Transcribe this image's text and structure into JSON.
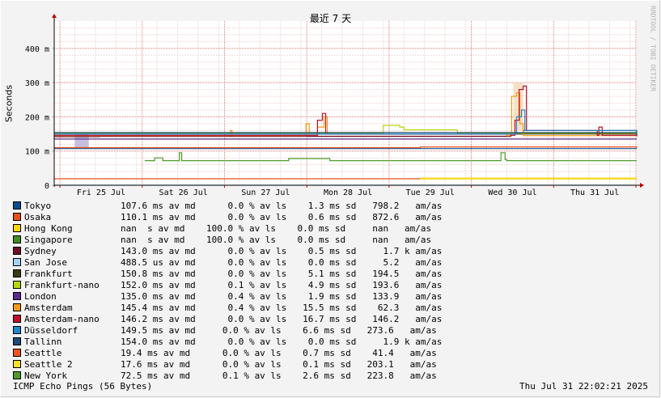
{
  "chart_data": {
    "type": "line",
    "title": "最近 7 天",
    "ylabel": "Seconds",
    "watermark": "RRDTOOL / TOBI OETIKER",
    "ylim": [
      0,
      0.48
    ],
    "yticks": [
      {
        "value": 0,
        "label": "0"
      },
      {
        "value": 0.1,
        "label": "100 m"
      },
      {
        "value": 0.2,
        "label": "200 m"
      },
      {
        "value": 0.3,
        "label": "300 m"
      },
      {
        "value": 0.4,
        "label": "400 m"
      }
    ],
    "xlim_days": [
      0,
      7.08
    ],
    "xticks": [
      {
        "day": 0.57,
        "label": "Fri 25 Jul"
      },
      {
        "day": 1.57,
        "label": "Sat 26 Jul"
      },
      {
        "day": 2.57,
        "label": "Sun 27 Jul"
      },
      {
        "day": 3.57,
        "label": "Mon 28 Jul"
      },
      {
        "day": 4.57,
        "label": "Tue 29 Jul"
      },
      {
        "day": 5.57,
        "label": "Wed 30 Jul"
      },
      {
        "day": 6.57,
        "label": "Thu 31 Jul"
      }
    ],
    "series": [
      {
        "name": "Tokyo",
        "color": "#0a4f8a",
        "points": [
          [
            0,
            0.107
          ],
          [
            7.08,
            0.107
          ]
        ]
      },
      {
        "name": "Osaka",
        "color": "#e8501d",
        "points": [
          [
            0,
            0.11
          ],
          [
            4.45,
            0.11
          ],
          [
            4.45,
            0.112
          ],
          [
            7.08,
            0.11
          ]
        ]
      },
      {
        "name": "Hong Kong",
        "color": "#f8d60f",
        "points": [
          [
            4.45,
            0.021
          ],
          [
            7.08,
            0.021
          ]
        ]
      },
      {
        "name": "Singapore",
        "color": "#3f8f1e",
        "points": [
          [
            0,
            0.0
          ],
          [
            0,
            0.0
          ]
        ]
      },
      {
        "name": "Sydney",
        "color": "#6b0f24",
        "points": [
          [
            0,
            0.142
          ],
          [
            0.55,
            0.142
          ],
          [
            0.55,
            0.143
          ],
          [
            5.5,
            0.143
          ],
          [
            5.55,
            0.15
          ],
          [
            5.7,
            0.16
          ],
          [
            7.08,
            0.143
          ]
        ]
      },
      {
        "name": "San Jose",
        "color": "#a7d3f2",
        "points": [
          [
            0,
            0.0005
          ],
          [
            7.08,
            0.0005
          ]
        ]
      },
      {
        "name": "Frankfurt",
        "color": "#3a3a14",
        "points": [
          [
            0,
            0.15
          ],
          [
            7.08,
            0.15
          ]
        ]
      },
      {
        "name": "Frankfurt-nano",
        "color": "#b8d40d",
        "points": [
          [
            0,
            0.152
          ],
          [
            4.0,
            0.152
          ],
          [
            4.0,
            0.175
          ],
          [
            4.2,
            0.17
          ],
          [
            4.25,
            0.162
          ],
          [
            4.9,
            0.162
          ],
          [
            4.9,
            0.152
          ],
          [
            7.08,
            0.152
          ]
        ]
      },
      {
        "name": "London",
        "color": "#5a2a8c",
        "points": [
          [
            0,
            0.135
          ],
          [
            7.08,
            0.135
          ]
        ]
      },
      {
        "name": "Amsterdam",
        "color": "#f49a1a",
        "points": [
          [
            0,
            0.145
          ],
          [
            2.12,
            0.145
          ],
          [
            2.14,
            0.16
          ],
          [
            2.16,
            0.145
          ],
          [
            3.0,
            0.145
          ],
          [
            3.06,
            0.18
          ],
          [
            3.1,
            0.15
          ],
          [
            3.2,
            0.17
          ],
          [
            3.28,
            0.2
          ],
          [
            3.32,
            0.15
          ],
          [
            5.5,
            0.145
          ],
          [
            5.56,
            0.26
          ],
          [
            5.62,
            0.27
          ],
          [
            5.66,
            0.18
          ],
          [
            5.7,
            0.145
          ],
          [
            7.08,
            0.145
          ]
        ]
      },
      {
        "name": "Amsterdam-nano",
        "color": "#c0102a",
        "points": [
          [
            0,
            0.146
          ],
          [
            3.15,
            0.146
          ],
          [
            3.2,
            0.19
          ],
          [
            3.26,
            0.21
          ],
          [
            3.3,
            0.15
          ],
          [
            5.55,
            0.146
          ],
          [
            5.6,
            0.19
          ],
          [
            5.65,
            0.28
          ],
          [
            5.7,
            0.29
          ],
          [
            5.74,
            0.16
          ],
          [
            6.6,
            0.146
          ],
          [
            6.62,
            0.17
          ],
          [
            6.66,
            0.146
          ],
          [
            7.08,
            0.146
          ]
        ]
      },
      {
        "name": "Düsseldorf",
        "color": "#1e88c9",
        "points": [
          [
            0,
            0.15
          ],
          [
            5.55,
            0.15
          ],
          [
            5.62,
            0.2
          ],
          [
            5.68,
            0.22
          ],
          [
            5.72,
            0.16
          ],
          [
            7.08,
            0.15
          ]
        ]
      },
      {
        "name": "Tallinn",
        "color": "#1c4a75",
        "points": [
          [
            0,
            0.154
          ],
          [
            7.08,
            0.154
          ]
        ]
      },
      {
        "name": "Seattle",
        "color": "#ee5522",
        "points": [
          [
            0,
            0.019
          ],
          [
            4.45,
            0.019
          ]
        ]
      },
      {
        "name": "Seattle 2",
        "color": "#f7df2a",
        "points": [
          [
            4.45,
            0.018
          ],
          [
            7.08,
            0.018
          ]
        ]
      },
      {
        "name": "New York",
        "color": "#4f9a2b",
        "points": [
          [
            1.1,
            0.072
          ],
          [
            1.2,
            0.072
          ],
          [
            1.22,
            0.08
          ],
          [
            1.3,
            0.08
          ],
          [
            1.32,
            0.072
          ],
          [
            1.5,
            0.072
          ],
          [
            1.52,
            0.095
          ],
          [
            1.55,
            0.072
          ],
          [
            2.8,
            0.072
          ],
          [
            2.85,
            0.078
          ],
          [
            3.3,
            0.078
          ],
          [
            3.35,
            0.072
          ],
          [
            5.4,
            0.072
          ],
          [
            5.43,
            0.095
          ],
          [
            5.48,
            0.075
          ],
          [
            5.5,
            0.072
          ],
          [
            7.08,
            0.072
          ]
        ]
      }
    ]
  },
  "legend": [
    {
      "name": "Tokyo",
      "stats": "         107.6 ms av md      0.0 % av ls    1.3 ms sd   798.2   am/as"
    },
    {
      "name": "Osaka",
      "stats": "         110.1 ms av md      0.0 % av ls    0.6 ms sd   872.6   am/as"
    },
    {
      "name": "Hong Kong",
      "stats": "           nan  s av md    100.0 % av ls    0.0 ms sd     nan   am/as"
    },
    {
      "name": "Singapore",
      "stats": "           nan  s av md    100.0 % av ls    0.0 ms sd     nan   am/as"
    },
    {
      "name": "Sydney",
      "stats": "         143.0 ms av md      0.0 % av ls    0.5 ms sd     1.7 k am/as"
    },
    {
      "name": "San Jose",
      "stats": "         488.5 us av md      0.0 % av ls    0.0 ms sd     5.2   am/as"
    },
    {
      "name": "Frankfurt",
      "stats": "         150.8 ms av md      0.0 % av ls    5.1 ms sd   194.5   am/as"
    },
    {
      "name": "Frankfurt-nano",
      "stats": "         152.0 ms av md      0.1 % av ls    4.9 ms sd   193.6   am/as"
    },
    {
      "name": "London",
      "stats": "         135.0 ms av md      0.4 % av ls    1.9 ms sd   133.9   am/as"
    },
    {
      "name": "Amsterdam",
      "stats": "         145.4 ms av md      0.4 % av ls   15.5 ms sd    62.3   am/as"
    },
    {
      "name": "Amsterdam-nano",
      "stats": "         146.2 ms av md      0.0 % av ls   16.7 ms sd   146.2   am/as"
    },
    {
      "name": "Düsseldorf",
      "stats": "        149.5 ms av md     0.0 % av ls    6.6 ms sd   273.6   am/as"
    },
    {
      "name": "Tallinn",
      "stats": "         154.0 ms av md      0.0 % av ls    0.0 ms sd     1.9 k am/as"
    },
    {
      "name": "Seattle",
      "stats": "          19.4 ms av md      0.0 % av ls    0.7 ms sd    41.4   am/as"
    },
    {
      "name": "Seattle 2",
      "stats": "          17.6 ms av md      0.0 % av ls    0.1 ms sd   203.1   am/as"
    },
    {
      "name": "New York",
      "stats": "          72.5 ms av md      0.1 % av ls    2.6 ms sd   223.8   am/as"
    }
  ],
  "footer": {
    "left": "ICMP Echo Pings (56 Bytes)",
    "right": "Thu Jul 31 22:02:21 2025"
  }
}
